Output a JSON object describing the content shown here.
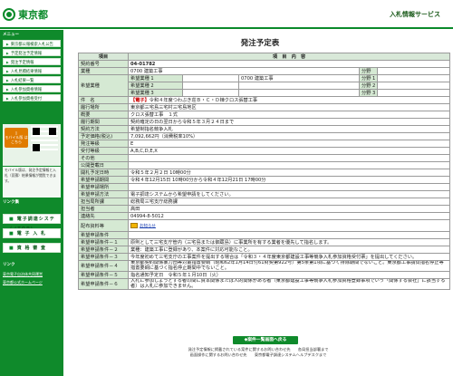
{
  "header": {
    "logo_text": "東京都",
    "service_title": "入札情報サービス"
  },
  "sidebar": {
    "menu_head": "メニュー",
    "items": [
      "東京都公報検索入札公告",
      "予定発注予定情報",
      "発注予定情報",
      "入札見積結果情報",
      "入札結果一覧",
      "入札参加資格情報",
      "入札参加資格受付"
    ],
    "mobile_label": "モバイル版\nはこちら",
    "mobile_text": "モバイル版は、発注予定情報と入札（見積）結果情報が閲覧できます。",
    "links_head": "リンク集",
    "big_buttons": [
      "電子調達システム(TOP)",
      "電 子 入 札",
      "資 格 審 査"
    ],
    "footer_links_head": "リンク",
    "footer_links": [
      "東京電子自治体共同運営",
      "東京都公式ホームページ"
    ]
  },
  "main": {
    "page_title": "発注予定表",
    "col_header_item": "項目",
    "col_header_content": "項　目　内　容",
    "rows": [
      {
        "label": "契約番号",
        "value": "04-01782"
      },
      {
        "label": "業種",
        "value": "0700 建築工事"
      }
    ],
    "wish_label": "希望業種",
    "wish_rows": [
      {
        "sub": "希望業種 1",
        "v1": "0700 建築工事",
        "v2": "",
        "bunya": "分野 1"
      },
      {
        "sub": "希望業種 2",
        "v1": "",
        "v2": "",
        "bunya": "分野 2"
      },
      {
        "sub": "希望業種 3",
        "v1": "",
        "v2": "",
        "bunya": "分野 3"
      }
    ],
    "kenmei_label": "件　名",
    "kenmei_tag": "【電子】",
    "kenmei_value": "令和４年度つわぶき荘Ｂ・Ｃ・Ｄ棟クロス張替工事",
    "rows2": [
      {
        "label": "履行場所",
        "value": "東京都三宅島三宅村三宅島地区"
      },
      {
        "label": "概要",
        "value": "クロス張替工事　１式"
      },
      {
        "label": "履行期間",
        "value": "契約確定の日の翌日から令和５年３月２４日まで"
      },
      {
        "label": "契約方法",
        "value": "希望制指名競争入札"
      },
      {
        "label": "予定価格(税込)",
        "value": "7,092,662円（消費税率10%）"
      },
      {
        "label": "発注等級",
        "value": "E"
      },
      {
        "label": "受付等級",
        "value": "A,B,C,D,E,X"
      },
      {
        "label": "その他",
        "value": ""
      },
      {
        "label": "公開登載日",
        "value": ""
      },
      {
        "label": "開札予定日時",
        "value": "令和５年２月２日 10時00分"
      },
      {
        "label": "希望申請期間",
        "value": "令和４年12月15日 10時00分から令和４年12月21日 17時00分"
      },
      {
        "label": "希望申請場所",
        "value": ""
      },
      {
        "label": "希望申請方法",
        "value": "電子調達システムから希望申請をしてください。"
      },
      {
        "label": "担当局所課",
        "value": "総務局三宅支庁総務課"
      },
      {
        "label": "担当者",
        "value": "高田"
      },
      {
        "label": "連絡先",
        "value": "04994-8-5012"
      }
    ],
    "attach_label": "配布資料等",
    "attach_link": "お知らせ",
    "cond_rows": [
      {
        "label": "希望申請条件",
        "value": ""
      },
      {
        "label": "希望申請条件－１",
        "value": "原則として三宅支庁管内（三宅島または御蔵島）に事業所を有する業者を優先して指名します。"
      },
      {
        "label": "希望申請条件－２",
        "value": "業種：建築工事に登録があり、本案件に対応可能なこと。"
      },
      {
        "label": "希望申請条件－３",
        "value": "今年度初めて三宅支庁の工事案件を提出する場合は「令和３・４年度東京都建設工事等競争入札参加資格受付票」を提出してください。"
      },
      {
        "label": "希望申請条件－４",
        "value": "東京都契約関係暴力団等対策措置要綱（昭和62年1月14日付61財契第922号）第5条第1項に基づく排除期間でないこと。東京都工事請負指名停止等措置要綱に基づく指名停止期間中でないこと。"
      },
      {
        "label": "希望申請条件－５",
        "value": "指名通知予定日　令和５年１月10日（火）"
      },
      {
        "label": "希望申請条件－６",
        "value": "入札に参加しようとする者の間に資本関係または人的関係がある者（東京都建設工事等競争入札参加資格登録事項でいう「関係する会社」に該当する者）は入札に参加できません。"
      }
    ],
    "back_button": "◆案件一覧画面へ戻る"
  },
  "footer": {
    "line1": "発注予定情報に掲載されている案件に関するお問い合わせ先　　各局担当部署まで",
    "line2": "画面操作に関するお問い合わせ先　　東京都電子調達システムヘルプデスクまで"
  },
  "colors": {
    "brand_green": "#0f8a2b",
    "label_bg": "#d5e9d3",
    "accent_red": "#cc0000"
  }
}
